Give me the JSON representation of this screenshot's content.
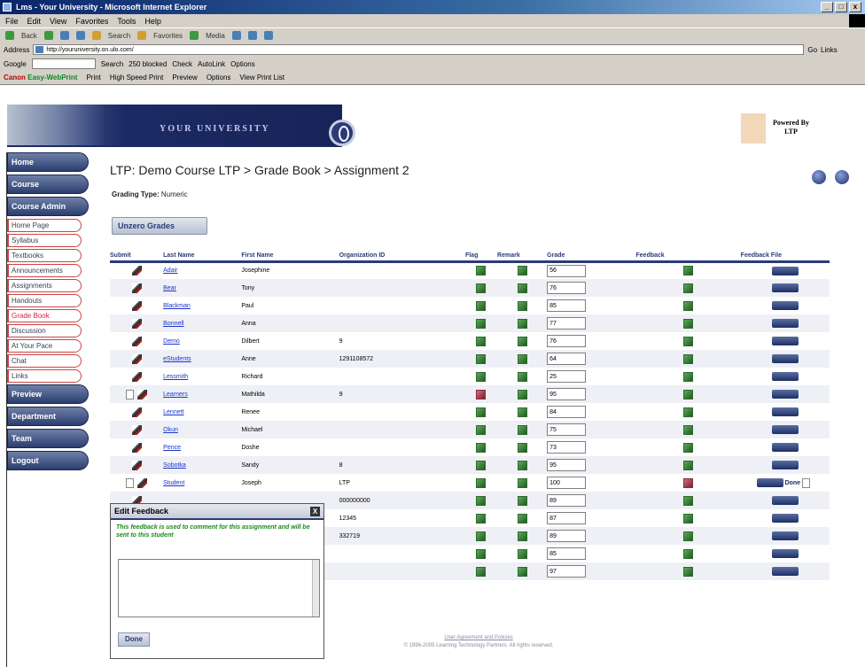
{
  "window": {
    "title": "Lms - Your University - Microsoft Internet Explorer",
    "menu": [
      "File",
      "Edit",
      "View",
      "Favorites",
      "Tools",
      "Help"
    ],
    "toolbar": [
      "Back",
      "Search",
      "Favorites",
      "Media"
    ],
    "address_label": "Address",
    "address_url": "http://youruniversity.on.ulo.com/",
    "go_label": "Go",
    "links_label": "Links",
    "google_label": "Google",
    "google_items": [
      "Search",
      "250 blocked",
      "Check",
      "AutoLink",
      "Options"
    ],
    "canon_label": "Canon",
    "ewp_label": "Easy-WebPrint",
    "canon_items": [
      "Print",
      "High Speed Print",
      "Preview",
      "Options",
      "View Print List"
    ]
  },
  "banner": {
    "university": "YOUR UNIVERSITY",
    "powered_by": "Powered By",
    "powered_name": "LTP"
  },
  "nav": {
    "home": "Home",
    "course": "Course",
    "course_admin": "Course Admin",
    "items": [
      {
        "label": "Home Page",
        "active": false
      },
      {
        "label": "Syllabus",
        "active": false
      },
      {
        "label": "Textbooks",
        "active": false
      },
      {
        "label": "Announcements",
        "active": false
      },
      {
        "label": "Assignments",
        "active": false
      },
      {
        "label": "Handouts",
        "active": false
      },
      {
        "label": "Grade Book",
        "active": true
      },
      {
        "label": "Discussion",
        "active": false
      },
      {
        "label": "At Your Pace",
        "active": false
      },
      {
        "label": "Chat",
        "active": false
      },
      {
        "label": "Links",
        "active": false
      }
    ],
    "preview": "Preview",
    "department": "Department",
    "team": "Team",
    "logout": "Logout"
  },
  "main": {
    "heading": "LTP: Demo Course LTP > Grade Book > Assignment 2",
    "grading_label": "Grading Type:",
    "grading_value": "Numeric",
    "unzero_label": "Unzero Grades"
  },
  "table": {
    "headers": [
      "Submit",
      "Last Name",
      "First Name",
      "Organization ID",
      "Flag",
      "Remark",
      "Grade",
      "Feedback",
      "Feedback File"
    ],
    "rows": [
      {
        "last": "Adair",
        "first": "Josephine",
        "org": "",
        "grade": "56"
      },
      {
        "last": "Bear",
        "first": "Tony",
        "org": "",
        "grade": "76"
      },
      {
        "last": "Blackman",
        "first": "Paul",
        "org": "",
        "grade": "85"
      },
      {
        "last": "Bonnell",
        "first": "Anna",
        "org": "",
        "grade": "77"
      },
      {
        "last": "Demo",
        "first": "Dilbert",
        "org": "9",
        "grade": "76"
      },
      {
        "last": "eStudents",
        "first": "Anne",
        "org": "1291108572",
        "grade": "64"
      },
      {
        "last": "Lessmith",
        "first": "Richard",
        "org": "",
        "grade": "25"
      },
      {
        "last": "Learners",
        "first": "Mathilda",
        "org": "9",
        "grade": "95"
      },
      {
        "last": "Lennett",
        "first": "Renee",
        "org": "",
        "grade": "84"
      },
      {
        "last": "Okun",
        "first": "Michael",
        "org": "",
        "grade": "75"
      },
      {
        "last": "Pence",
        "first": "Doshe",
        "org": "",
        "grade": "73"
      },
      {
        "last": "Sobotka",
        "first": "Sandy",
        "org": "8",
        "grade": "95"
      },
      {
        "last": "Student",
        "first": "Joseph",
        "org": "LTP",
        "grade": "100"
      },
      {
        "last": "",
        "first": "",
        "org": "000000000",
        "grade": "89"
      },
      {
        "last": "",
        "first": "",
        "org": "12345",
        "grade": "87"
      },
      {
        "last": "",
        "first": "",
        "org": "332719",
        "grade": "89"
      },
      {
        "last": "",
        "first": "",
        "org": "",
        "grade": "85"
      },
      {
        "last": "",
        "first": "",
        "org": "",
        "grade": "97"
      }
    ],
    "done_label": "Done"
  },
  "feedback_window": {
    "title": "Edit Feedback",
    "message": "This feedback is used to comment for this assignment and will be sent to this student",
    "done": "Done",
    "close": "X"
  },
  "footer": {
    "link": "User Agreement and Policies",
    "copyright": "© 1996-2005 Learning Technology Partners. All rights reserved."
  }
}
